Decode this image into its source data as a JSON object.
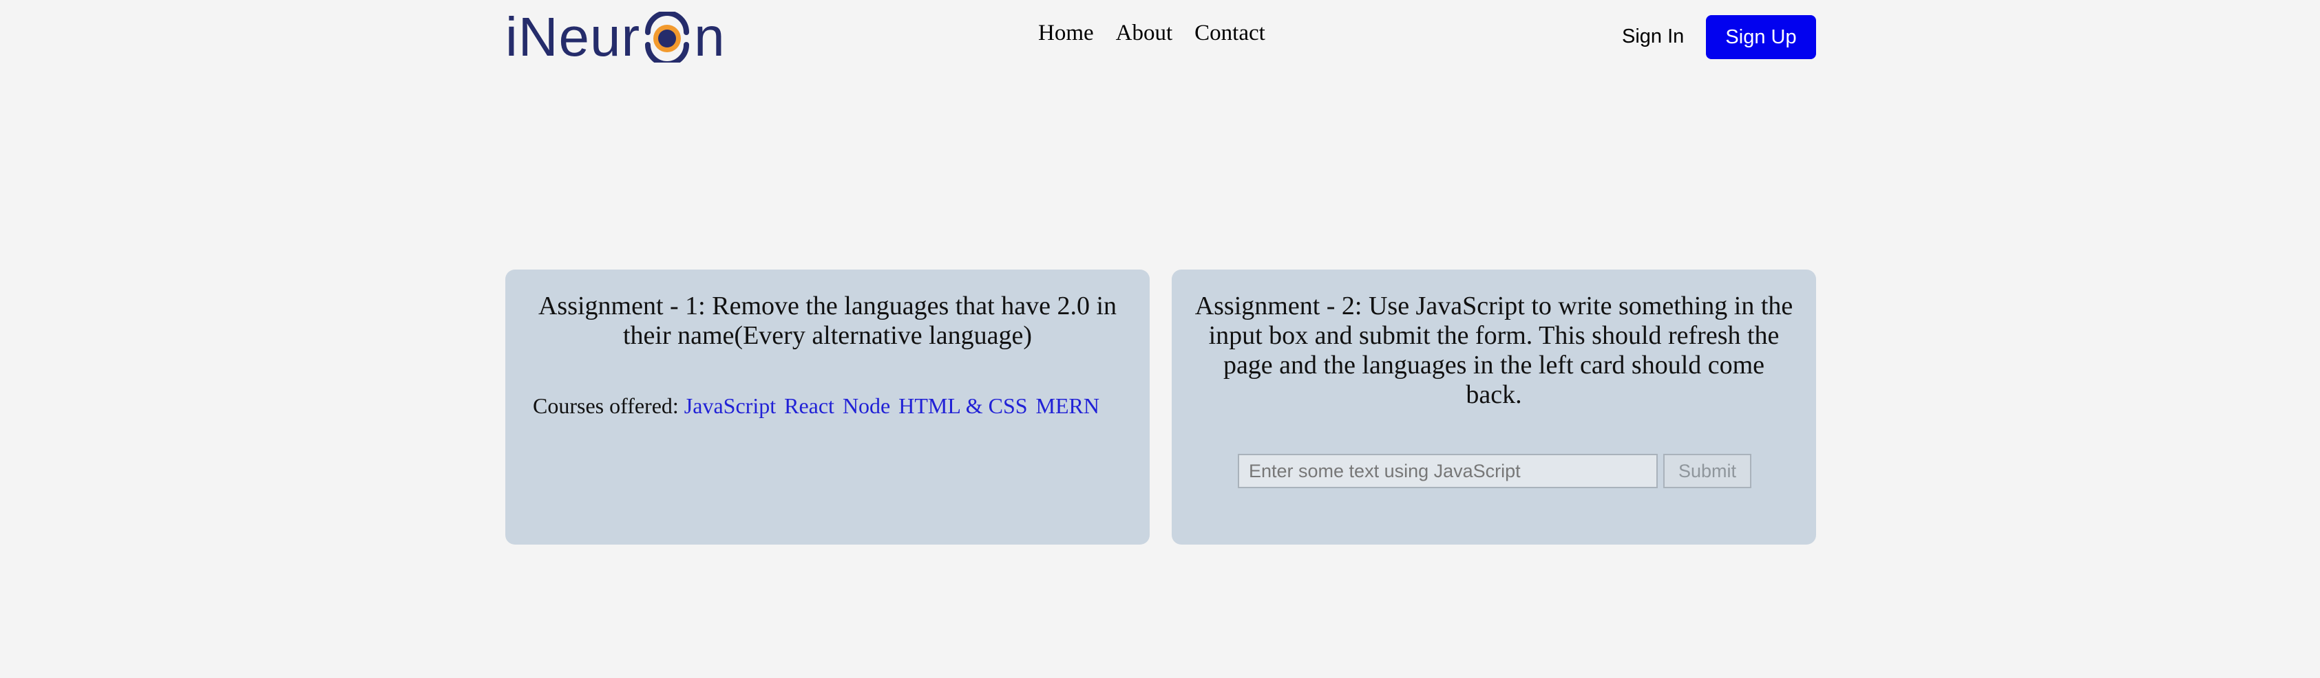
{
  "header": {
    "logo": {
      "prefix": "iNeur",
      "suffix": "n"
    },
    "nav": [
      {
        "label": "Home"
      },
      {
        "label": "About"
      },
      {
        "label": "Contact"
      }
    ],
    "signin_label": "Sign In",
    "signup_label": "Sign Up"
  },
  "assignment1": {
    "title": "Assignment - 1: Remove the languages that have 2.0 in their name(Every alternative language)",
    "courses_label": "Courses offered:",
    "courses": [
      "JavaScript",
      "React",
      "Node",
      "HTML & CSS",
      "MERN"
    ]
  },
  "assignment2": {
    "title": "Assignment - 2: Use JavaScript to write something in the input box and submit the form. This should refresh the page and the languages in the left card should come back.",
    "input_placeholder": "Enter some text using JavaScript",
    "input_value": "",
    "submit_label": "Submit"
  },
  "colors": {
    "background": "#f4f4f4",
    "card": "#cad5e0",
    "brand_navy": "#252c6b",
    "logo_orange": "#f29a2e",
    "signup_button": "#0202ef",
    "course_link": "#2121d6"
  }
}
